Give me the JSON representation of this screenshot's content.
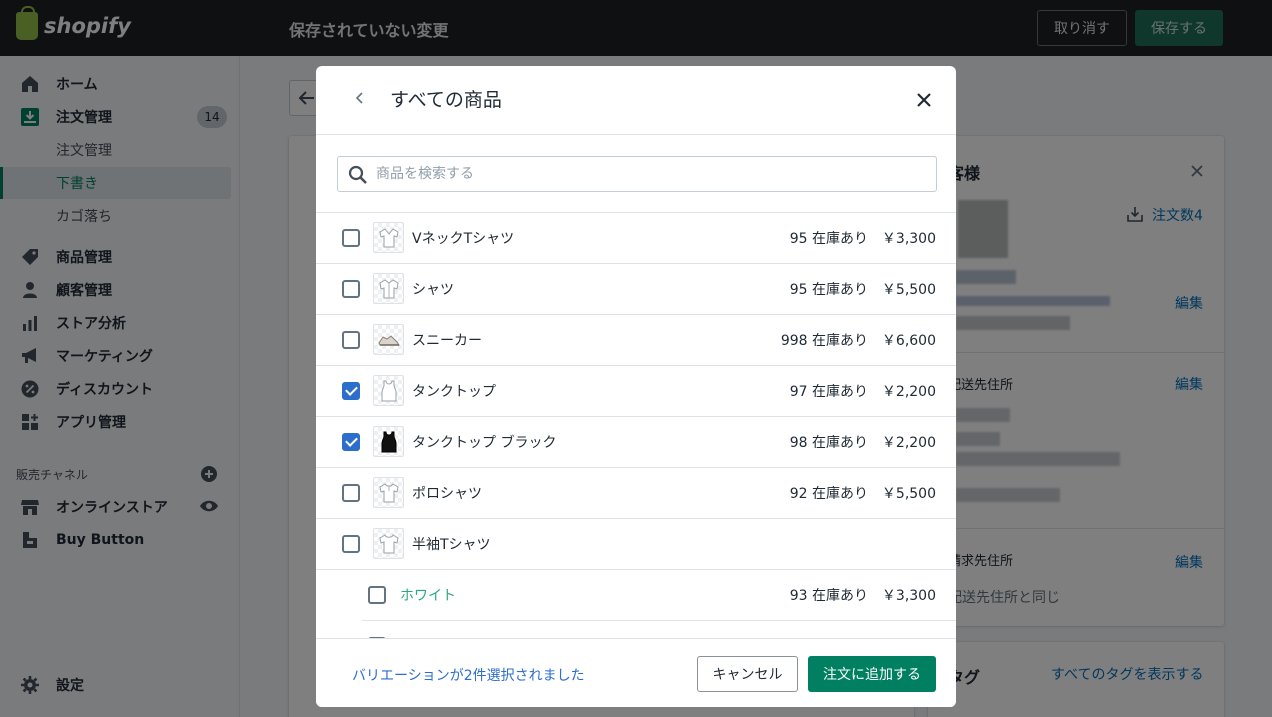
{
  "topbar": {
    "logo_text": "shopify",
    "title": "保存されていない変更",
    "discard_label": "取り消す",
    "save_label": "保存する"
  },
  "sidebar": {
    "home": "ホーム",
    "orders": "注文管理",
    "orders_badge": "14",
    "sub_orders": "注文管理",
    "sub_drafts": "下書き",
    "sub_abandoned": "カゴ落ち",
    "products": "商品管理",
    "customers": "顧客管理",
    "analytics": "ストア分析",
    "marketing": "マーケティング",
    "discounts": "ディスカウント",
    "apps": "アプリ管理",
    "channels_label": "販売チャネル",
    "online_store": "オンラインストア",
    "buy_button": "Buy Button",
    "settings": "設定"
  },
  "background": {
    "customer_title": "客様",
    "order_count": "注文数4",
    "edit": "編集",
    "shipping_title": "配送先住所",
    "billing_title": "請求先住所",
    "billing_same": "配送先住所と同じ",
    "tags_title": "タグ",
    "show_all_tags": "すべてのタグを表示する"
  },
  "modal": {
    "title": "すべての商品",
    "search_placeholder": "商品を検索する",
    "products": [
      {
        "name": "VネックTシャツ",
        "stock": "95 在庫あり",
        "price": "￥3,300",
        "checked": false
      },
      {
        "name": "シャツ",
        "stock": "95 在庫あり",
        "price": "￥5,500",
        "checked": false
      },
      {
        "name": "スニーカー",
        "stock": "998 在庫あり",
        "price": "￥6,600",
        "checked": false
      },
      {
        "name": "タンクトップ",
        "stock": "97 在庫あり",
        "price": "￥2,200",
        "checked": true
      },
      {
        "name": "タンクトップ ブラック",
        "stock": "98 在庫あり",
        "price": "￥2,200",
        "checked": true
      },
      {
        "name": "ポロシャツ",
        "stock": "92 在庫あり",
        "price": "￥5,500",
        "checked": false
      },
      {
        "name": "半袖Tシャツ",
        "stock": "",
        "price": "",
        "checked": false
      }
    ],
    "variants": [
      {
        "name": "ホワイト",
        "stock": "93 在庫あり",
        "price": "￥3,300",
        "checked": false
      }
    ],
    "selected_text": "バリエーションが2件選択されました",
    "cancel_label": "キャンセル",
    "add_label": "注文に追加する"
  },
  "colors": {
    "primary": "#008060",
    "checkbox_checked": "#2c6ecb",
    "topbar": "#1c2023",
    "variant_text": "#2aa884"
  }
}
